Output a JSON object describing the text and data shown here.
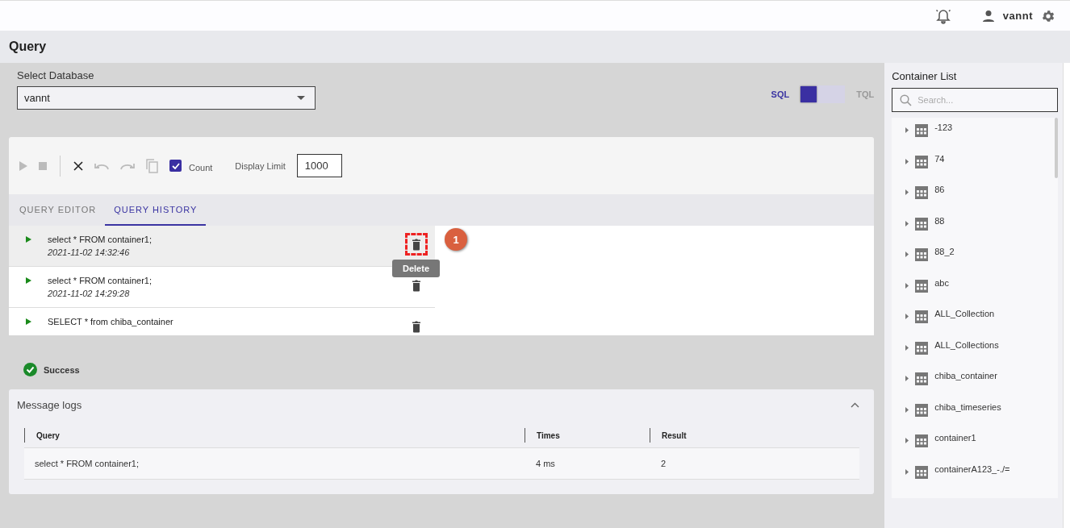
{
  "top_bar": {
    "user": "vannt"
  },
  "page_title": "Query",
  "database": {
    "label": "Select Database",
    "value": "vannt"
  },
  "language_toggle": [
    {
      "label": "SQL",
      "selected": true
    },
    {
      "label": "TQL",
      "selected": false
    }
  ],
  "toolbar": {
    "count": {
      "label": "Count",
      "checked": true
    },
    "display_limit": {
      "label": "Display Limit",
      "value": "1000"
    }
  },
  "tabs": [
    {
      "label": "QUERY EDITOR",
      "selected": false
    },
    {
      "label": "QUERY HISTORY",
      "selected": true
    }
  ],
  "history": [
    {
      "query": "select * FROM container1;",
      "time": "2021-11-02 14:32:46",
      "highlighted": true
    },
    {
      "query": "select * FROM container1;",
      "time": "2021-11-02 14:29:28",
      "highlighted": false
    },
    {
      "query": "SELECT * from chiba_container",
      "highlighted": false
    }
  ],
  "annotation": {
    "badge": "1",
    "tooltip": "Delete"
  },
  "status": "Success",
  "message_logs": {
    "title": "Message logs",
    "columns": [
      "Query",
      "Times",
      "Result"
    ],
    "rows": [
      [
        "select * FROM container1;",
        "4 ms",
        "2"
      ]
    ]
  },
  "container_list": {
    "title": "Container List",
    "search_placeholder": "Search...",
    "items": [
      "-123",
      "74",
      "86",
      "88",
      "88_2",
      "abc",
      "ALL_Collection",
      "ALL_Collections",
      "chiba_container",
      "chiba_timeseries",
      "container1",
      "containerA123_-./="
    ]
  }
}
